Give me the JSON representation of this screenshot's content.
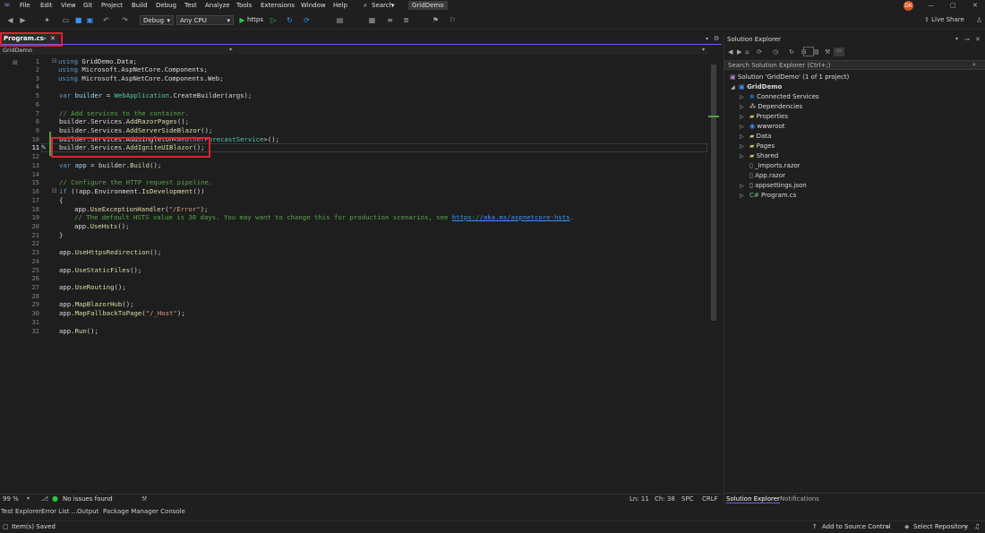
{
  "menu": [
    "File",
    "Edit",
    "View",
    "Git",
    "Project",
    "Build",
    "Debug",
    "Test",
    "Analyze",
    "Tools",
    "Extensions",
    "Window",
    "Help"
  ],
  "search_label": "Search",
  "solution_name_badge": "GridDemo",
  "user_initials": "DK",
  "live_share": "Live Share",
  "toolbar": {
    "config": "Debug",
    "platform": "Any CPU",
    "run_profile": "https"
  },
  "tab": {
    "label": "Program.cs"
  },
  "navbar": {
    "project": "GridDemo"
  },
  "line_numbers": [
    "1",
    "2",
    "3",
    "4",
    "5",
    "6",
    "7",
    "8",
    "9",
    "10",
    "11",
    "12",
    "13",
    "14",
    "15",
    "16",
    "17",
    "18",
    "19",
    "20",
    "21",
    "22",
    "23",
    "24",
    "25",
    "26",
    "27",
    "28",
    "29",
    "30",
    "31",
    "32"
  ],
  "code": {
    "l1_kw": "using",
    "l1_rest": " GridDemo.Data;",
    "l2_kw": "using",
    "l2_rest": " Microsoft.AspNetCore.Components;",
    "l3_kw": "using",
    "l3_rest": " Microsoft.AspNetCore.Components.Web;",
    "l5_kw": "var",
    "l5_var": " builder",
    "l5_eq": " = ",
    "l5_type": "WebApplication",
    "l5_rest": ".CreateBuilder(args);",
    "l7": "// Add services to the container.",
    "l8_a": "builder.Services.",
    "l8_m": "AddRazorPages",
    "l8_b": "();",
    "l9_a": "builder.Services.",
    "l9_m": "AddServerSideBlazor",
    "l9_b": "();",
    "l10_a": "builder.Services.AddSingleton<",
    "l10_t": "WeatherForecastService",
    "l10_b": ">();",
    "l11_a": "builder.Services.",
    "l11_m": "AddIgniteUIBlazor",
    "l11_b": "();",
    "l13_kw": "var",
    "l13_var": " app",
    "l13_rest": " = builder.",
    "l13_m": "Build",
    "l13_b": "();",
    "l15": "// Configure the HTTP request pipeline.",
    "l16_kw": "if",
    "l16_rest": " (!app.Environment.",
    "l16_m": "IsDevelopment",
    "l16_b": "())",
    "l17": "{",
    "l18_a": "app.",
    "l18_m": "UseExceptionHandler",
    "l18_b": "(",
    "l18_s": "\"/Error\"",
    "l18_c": ");",
    "l19": "// The default HSTS value is 30 days. You may want to change this for production scenarios, see ",
    "l19_link": "https://aka.ms/aspnetcore-hsts",
    "l19_end": ".",
    "l20_a": "app.",
    "l20_m": "UseHsts",
    "l20_b": "();",
    "l21": "}",
    "l23_a": "app.",
    "l23_m": "UseHttpsRedirection",
    "l23_b": "();",
    "l25_a": "app.",
    "l25_m": "UseStaticFiles",
    "l25_b": "();",
    "l27_a": "app.",
    "l27_m": "UseRouting",
    "l27_b": "();",
    "l29_a": "app.",
    "l29_m": "MapBlazorHub",
    "l29_b": "();",
    "l30_a": "app.",
    "l30_m": "MapFallbackToPage",
    "l30_b": "(",
    "l30_s": "\"/_Host\"",
    "l30_c": ");",
    "l32_a": "app.",
    "l32_m": "Run",
    "l32_b": "();"
  },
  "status": {
    "zoom": "99 %",
    "issues": "No issues found",
    "ln": "Ln: 11",
    "ch": "Ch: 38",
    "spc": "SPC",
    "crlf": "CRLF"
  },
  "bottom_tabs": [
    "Test Explorer",
    "Error List ...",
    "Output",
    "Package Manager Console"
  ],
  "item_saved": "Item(s) Saved",
  "add_source_control": "Add to Source Control",
  "select_repo": "Select Repository",
  "solution_explorer": {
    "title": "Solution Explorer",
    "search_placeholder": "Search Solution Explorer (Ctrl+;)",
    "solution": "Solution 'GridDemo' (1 of 1 project)",
    "project": "GridDemo",
    "items": [
      "Connected Services",
      "Dependencies",
      "Properties",
      "wwwroot",
      "Data",
      "Pages",
      "Shared",
      "_Imports.razor",
      "App.razor",
      "appsettings.json",
      "Program.cs"
    ],
    "tabs": [
      "Solution Explorer",
      "Notifications"
    ]
  }
}
